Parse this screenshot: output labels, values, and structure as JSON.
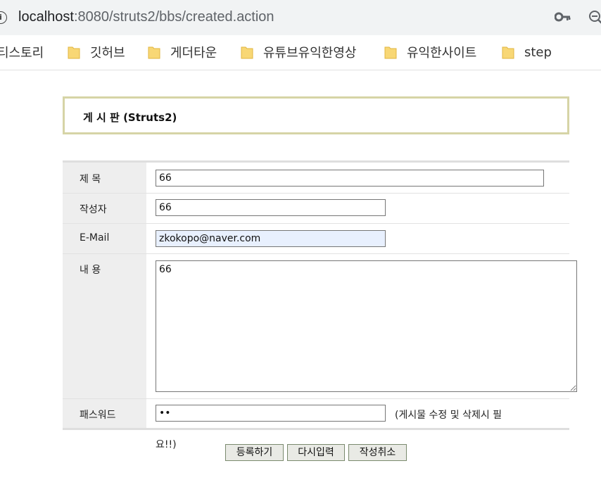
{
  "browser": {
    "url_host": "localhost",
    "url_rest": ":8080/struts2/bbs/created.action"
  },
  "bookmarks": [
    {
      "label": "티스토리"
    },
    {
      "label": "깃허브"
    },
    {
      "label": "게더타운"
    },
    {
      "label": "유튜브유익한영상"
    },
    {
      "label": "유익한사이트"
    },
    {
      "label": "step"
    }
  ],
  "board": {
    "title": "게 시 판 (Struts2)"
  },
  "form": {
    "subject_label": "제      목",
    "subject_value": "66",
    "writer_label": "작성자",
    "writer_value": "66",
    "email_label": "E-Mail",
    "email_value": "zkokopo@naver.com",
    "content_label": "내      용",
    "content_value": "66",
    "password_label": "패스워드",
    "password_value": "••",
    "password_note_1": "(게시물 수정 및 삭제시 필",
    "password_note_2": "요!!)"
  },
  "buttons": {
    "submit": "등록하기",
    "reset": "다시입력",
    "cancel": "작성취소"
  }
}
